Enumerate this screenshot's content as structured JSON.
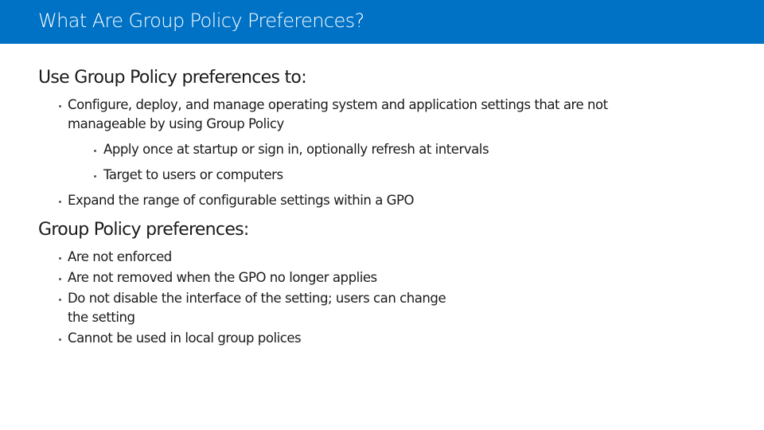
{
  "slide": {
    "title": "What Are Group Policy Preferences?",
    "section1": {
      "heading": "Use Group Policy preferences to:",
      "items": [
        {
          "line1": "Configure, deploy, and manage operating system and application settings that are not",
          "line2": "manageable by using Group Policy"
        },
        {
          "text": "Apply once at startup or sign in, optionally refresh at intervals"
        },
        {
          "text": "Target to users or computers"
        },
        {
          "text": "Expand the range of configurable settings within a GPO"
        }
      ]
    },
    "section2": {
      "heading": "Group Policy preferences:",
      "items": [
        {
          "text": "Are not enforced"
        },
        {
          "text": "Are not removed when the GPO no longer applies"
        },
        {
          "line1": "Do not disable the interface of the setting; users can change",
          "line2": "the setting"
        },
        {
          "text": "Cannot be used in local group polices"
        }
      ]
    }
  }
}
